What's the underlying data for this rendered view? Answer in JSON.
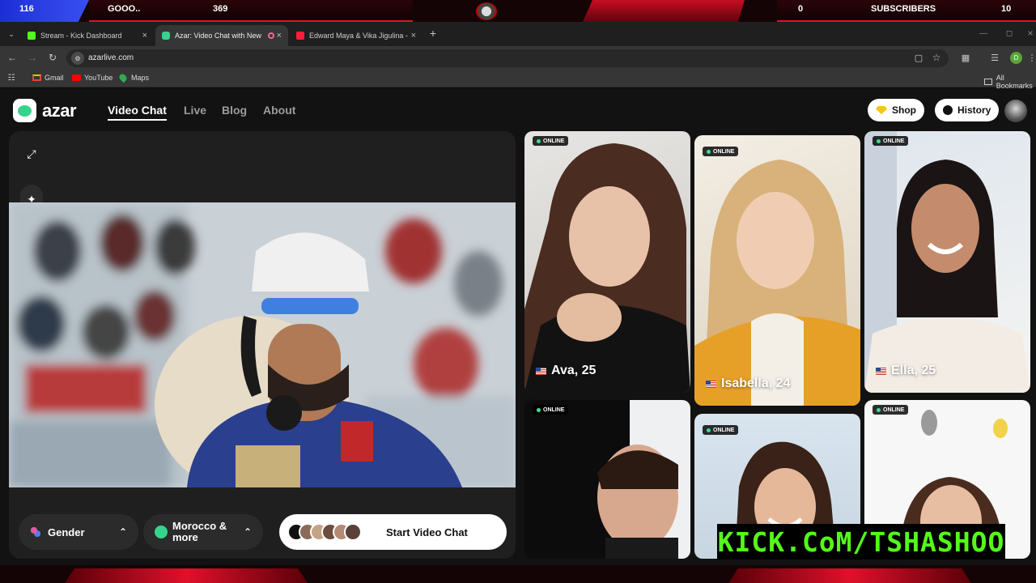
{
  "overlay": {
    "left_count": "116",
    "goal_label": "GOOO..",
    "goal_count": "369",
    "sub_count": "0",
    "subscribers_label": "SUBSCRIBERS",
    "right_count": "10",
    "accent": "#e0102a"
  },
  "browser": {
    "tabs": [
      {
        "title": "Stream - Kick Dashboard",
        "favicon": "kick-icon"
      },
      {
        "title": "Azar: Video Chat with New",
        "favicon": "azar-icon"
      },
      {
        "title": "Edward Maya & Vika Jigulina -",
        "favicon": "youtube-icon"
      }
    ],
    "url": "azarlive.com",
    "bookmarks": [
      "Gmail",
      "YouTube",
      "Maps"
    ],
    "all_bookmarks": "All Bookmarks",
    "profile_initial": "D"
  },
  "site": {
    "logo": "azar",
    "nav": [
      "Video Chat",
      "Live",
      "Blog",
      "About"
    ],
    "shop_label": "Shop",
    "history_label": "History",
    "gender_label": "Gender",
    "region_label_1": "Morocco &",
    "region_label_2": "more",
    "start_label": "Start Video Chat",
    "brand_green": "#36d38c"
  },
  "cards": [
    {
      "badge": "ONLINE",
      "name": "Ava, 25"
    },
    {
      "badge": "ONLINE",
      "name": "Isabella, 24"
    },
    {
      "badge": "ONLINE",
      "name": "Ella, 25"
    },
    {
      "badge": "ONLINE",
      "name": ""
    },
    {
      "badge": "ONLINE",
      "name": ""
    },
    {
      "badge": "ONLINE",
      "name": ""
    }
  ],
  "stream_banner": "KICK.CoM/TSHASHOO"
}
